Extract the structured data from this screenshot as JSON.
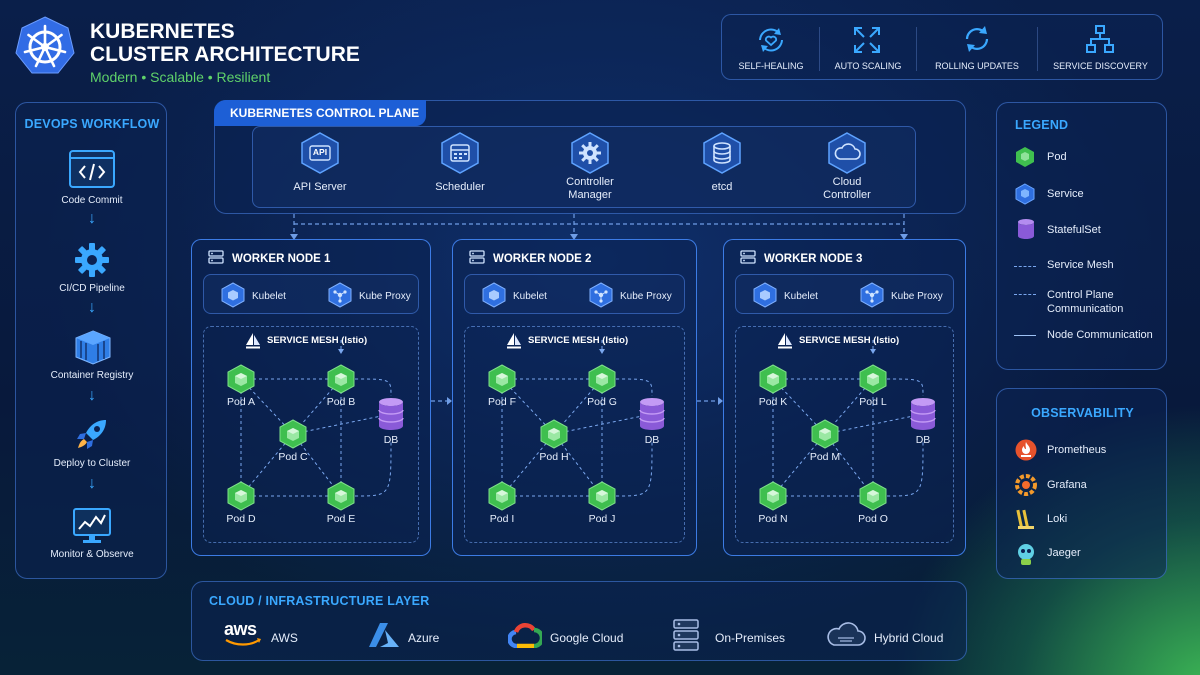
{
  "header": {
    "title_line1": "KUBERNETES",
    "title_line2": "CLUSTER ARCHITECTURE",
    "tagline": "Modern • Scalable • Resilient"
  },
  "features": [
    {
      "label": "SELF-HEALING",
      "icon": "self-healing-icon"
    },
    {
      "label": "AUTO SCALING",
      "icon": "auto-scaling-icon"
    },
    {
      "label": "ROLLING UPDATES",
      "icon": "rolling-updates-icon"
    },
    {
      "label": "SERVICE DISCOVERY",
      "icon": "service-discovery-icon"
    }
  ],
  "devops": {
    "title": "DEVOPS WORKFLOW",
    "steps": [
      {
        "label": "Code Commit",
        "icon": "code-icon"
      },
      {
        "label": "CI/CD Pipeline",
        "icon": "gear-icon"
      },
      {
        "label": "Container Registry",
        "icon": "container-icon"
      },
      {
        "label": "Deploy to Cluster",
        "icon": "rocket-icon"
      },
      {
        "label": "Monitor & Observe",
        "icon": "monitor-icon"
      }
    ]
  },
  "control_plane": {
    "title": "KUBERNETES CONTROL PLANE",
    "components": [
      {
        "label": "API Server",
        "icon": "api-icon",
        "icon_text": "API"
      },
      {
        "label": "Scheduler",
        "icon": "calendar-icon"
      },
      {
        "label": "Controller\nManager",
        "icon": "gear-icon"
      },
      {
        "label": "etcd",
        "icon": "database-icon"
      },
      {
        "label": "Cloud\nController",
        "icon": "cloud-icon"
      }
    ]
  },
  "workers": [
    {
      "title": "WORKER NODE 1",
      "kubelet": "Kubelet",
      "proxy": "Kube Proxy",
      "mesh": "SERVICE MESH (Istio)",
      "pods": [
        "Pod A",
        "Pod B",
        "Pod C",
        "Pod D",
        "Pod E"
      ],
      "db": "DB"
    },
    {
      "title": "WORKER NODE 2",
      "kubelet": "Kubelet",
      "proxy": "Kube Proxy",
      "mesh": "SERVICE MESH (Istio)",
      "pods": [
        "Pod F",
        "Pod G",
        "Pod H",
        "Pod I",
        "Pod J"
      ],
      "db": "DB"
    },
    {
      "title": "WORKER NODE 3",
      "kubelet": "Kubelet",
      "proxy": "Kube Proxy",
      "mesh": "SERVICE MESH (Istio)",
      "pods": [
        "Pod K",
        "Pod L",
        "Pod M",
        "Pod N",
        "Pod O"
      ],
      "db": "DB"
    }
  ],
  "legend": {
    "title": "LEGEND",
    "items": [
      {
        "label": "Pod",
        "icon": "pod-hex-icon",
        "color": "#3fbf4f"
      },
      {
        "label": "Service",
        "icon": "service-hex-icon",
        "color": "#2f6fe0"
      },
      {
        "label": "StatefulSet",
        "icon": "statefulset-icon",
        "color": "#9a68e6"
      },
      {
        "label": "Service Mesh",
        "icon": "dashed-line-icon"
      },
      {
        "label": "Control Plane\nCommunication",
        "icon": "dashed-line-icon"
      },
      {
        "label": "Node Communication",
        "icon": "solid-line-icon"
      }
    ]
  },
  "observability": {
    "title": "OBSERVABILITY",
    "items": [
      {
        "label": "Prometheus",
        "icon": "prometheus-icon",
        "color": "#e6522c"
      },
      {
        "label": "Grafana",
        "icon": "grafana-icon",
        "color": "#f49a2b"
      },
      {
        "label": "Loki",
        "icon": "loki-icon",
        "color": "#e8c13a"
      },
      {
        "label": "Jaeger",
        "icon": "jaeger-icon",
        "color": "#60d0e4"
      }
    ]
  },
  "infrastructure": {
    "title": "CLOUD / INFRASTRUCTURE LAYER",
    "providers": [
      {
        "label": "AWS",
        "icon": "aws-icon",
        "logo_text": "aws"
      },
      {
        "label": "Azure",
        "icon": "azure-icon"
      },
      {
        "label": "Google Cloud",
        "icon": "google-cloud-icon"
      },
      {
        "label": "On-Premises",
        "icon": "server-icon"
      },
      {
        "label": "Hybrid Cloud",
        "icon": "hybrid-cloud-icon"
      }
    ]
  },
  "colors": {
    "accent": "#3aa8ff",
    "pod": "#3fbf4f",
    "service": "#2f6fe0",
    "db": "#9a68e6",
    "tagline": "#5fd26a"
  }
}
